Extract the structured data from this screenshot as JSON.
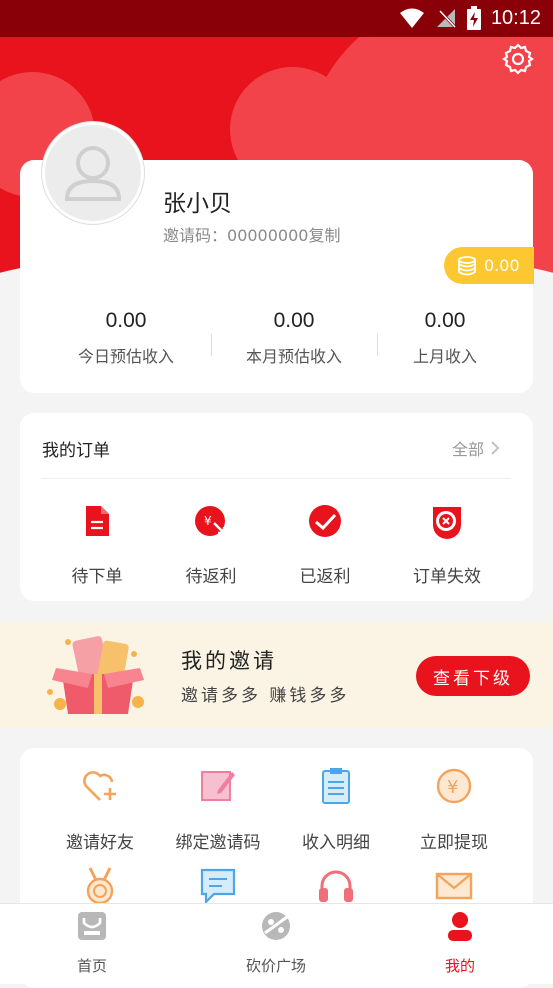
{
  "status_bar": {
    "time": "10:12"
  },
  "profile": {
    "username": "张小贝",
    "invite_code_label": "邀请码：",
    "invite_code": "00000000",
    "copy_label": "复制",
    "coin_balance": "0.00",
    "stats": [
      {
        "value": "0.00",
        "label": "今日预估收入"
      },
      {
        "value": "0.00",
        "label": "本月预估收入"
      },
      {
        "value": "0.00",
        "label": "上月收入"
      }
    ]
  },
  "orders": {
    "title": "我的订单",
    "all_label": "全部",
    "items": [
      {
        "label": "待下单",
        "icon": "doc-icon"
      },
      {
        "label": "待返利",
        "icon": "yen-arrow-icon"
      },
      {
        "label": "已返利",
        "icon": "check-icon"
      },
      {
        "label": "订单失效",
        "icon": "invalid-icon"
      }
    ]
  },
  "invite": {
    "title": "我的邀请",
    "subtitle": "邀请多多 赚钱多多",
    "button": "查看下级"
  },
  "tools": [
    {
      "label": "邀请好友",
      "icon": "heart-plus-icon"
    },
    {
      "label": "绑定邀请码",
      "icon": "edit-icon"
    },
    {
      "label": "收入明细",
      "icon": "clipboard-icon"
    },
    {
      "label": "立即提现",
      "icon": "yen-coin-icon"
    },
    {
      "label": "",
      "icon": "medal-icon"
    },
    {
      "label": "",
      "icon": "message-icon"
    },
    {
      "label": "",
      "icon": "headset-icon"
    },
    {
      "label": "",
      "icon": "mail-icon"
    }
  ],
  "nav": [
    {
      "label": "首页",
      "icon": "home-icon"
    },
    {
      "label": "砍价广场",
      "icon": "bargain-icon"
    },
    {
      "label": "我的",
      "icon": "profile-icon"
    }
  ],
  "colors": {
    "primary": "#e8131c",
    "status_bar": "#8a0008",
    "coin": "#fcc730",
    "banner_bg": "#fbf4e4"
  }
}
